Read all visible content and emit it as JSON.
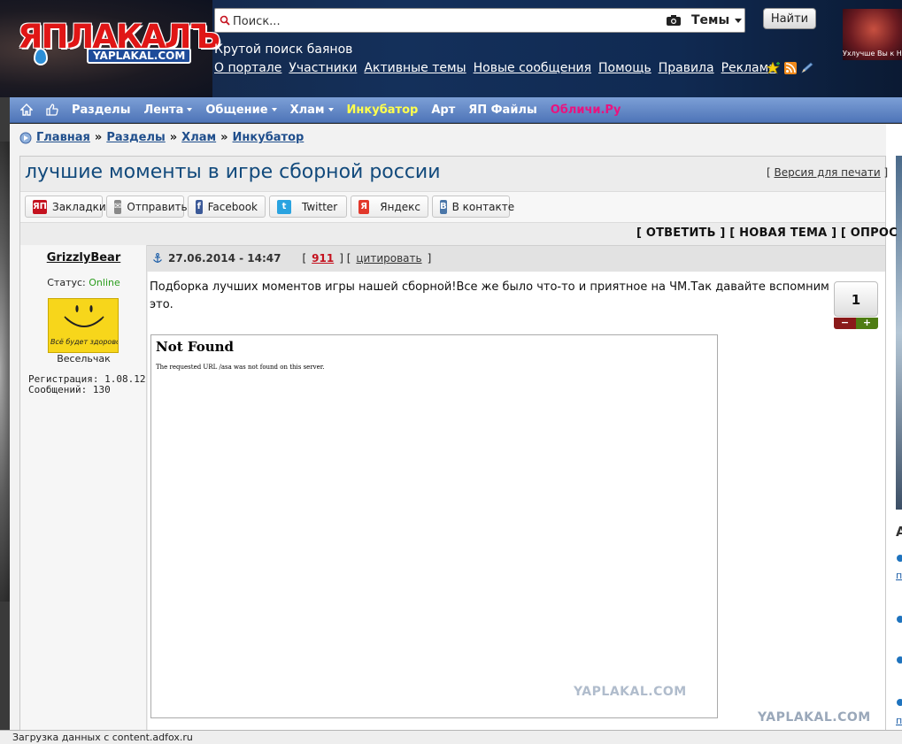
{
  "header": {
    "logo_text": "ЯПЛАКАЛЪ",
    "logo_sub": "YAPLAKAL.COM",
    "search_placeholder": "Поиск...",
    "themes_label": "Темы",
    "find_button": "Найти",
    "tagline": "Крутой поиск баянов",
    "nav_links": [
      "О портале",
      "Участники",
      "Активные темы",
      "Новые сообщения",
      "Помощь",
      "Правила",
      "Реклама"
    ],
    "banner_caption": "Ухлучше Вы к НА"
  },
  "mainnav": {
    "items": [
      {
        "label": "Разделы",
        "dropdown": false
      },
      {
        "label": "Лента",
        "dropdown": true
      },
      {
        "label": "Общение",
        "dropdown": true
      },
      {
        "label": "Хлам",
        "dropdown": true
      },
      {
        "label": "Инкубатор",
        "dropdown": false,
        "color": "#ffff4d"
      },
      {
        "label": "Арт",
        "dropdown": false
      },
      {
        "label": "ЯП Файлы",
        "dropdown": false
      },
      {
        "label": "Обличи.Ру",
        "dropdown": false,
        "color": "#e8147f"
      }
    ]
  },
  "breadcrumb": [
    "Главная",
    "Разделы",
    "Хлам",
    "Инкубатор"
  ],
  "breadcrumb_sep": "»",
  "topic": {
    "title": "лучшие моменты в игре сборной россии",
    "print_link": "Версия для печати"
  },
  "share": [
    {
      "label": "Закладки",
      "icon": "yap-icon",
      "color": "#c4121f",
      "glyph": "ЯП"
    },
    {
      "label": "Отправить",
      "icon": "envelope-icon",
      "color": "#888888",
      "glyph": "✉"
    },
    {
      "label": "Facebook",
      "icon": "facebook-icon",
      "color": "#3b5998",
      "glyph": "f"
    },
    {
      "label": "Twitter",
      "icon": "twitter-icon",
      "color": "#2aa3e0",
      "glyph": "t"
    },
    {
      "label": "Яндекс",
      "icon": "yandex-icon",
      "color": "#e2382b",
      "glyph": "Я"
    },
    {
      "label": "В контакте",
      "icon": "vk-icon",
      "color": "#4a76a8",
      "glyph": "В"
    }
  ],
  "actions": "[ ОТВЕТИТЬ ] [ НОВАЯ ТЕМА ] [ ОПРОС ]",
  "post": {
    "author": "GrizzlyBear",
    "status_label": "Статус:",
    "status_value": "Online",
    "avatar_text": "Всё будет здорово!",
    "rank": "Весельчак",
    "registration": "Регистрация: 1.08.12",
    "messages": "Сообщений: 130",
    "date": "27.06.2014 - 14:47",
    "rep_value": "911",
    "quote_label": "цитировать",
    "text": "Подборка лучших моментов игры нашей сборной!Все же было что-то и приятное на ЧМ.Так давайте вспомним это.",
    "vote_value": "1",
    "vote_minus": "−",
    "vote_plus": "+",
    "embed_title": "Not Found",
    "embed_message": "The requested URL /asa was not found on this server.",
    "embed_watermark": "YAPLAKAL.COM"
  },
  "right_panel": {
    "letter": "А",
    "link": "п"
  },
  "page_watermark": "YAPLAKAL.COM",
  "statusbar": "Загрузка данных с content.adfox.ru"
}
